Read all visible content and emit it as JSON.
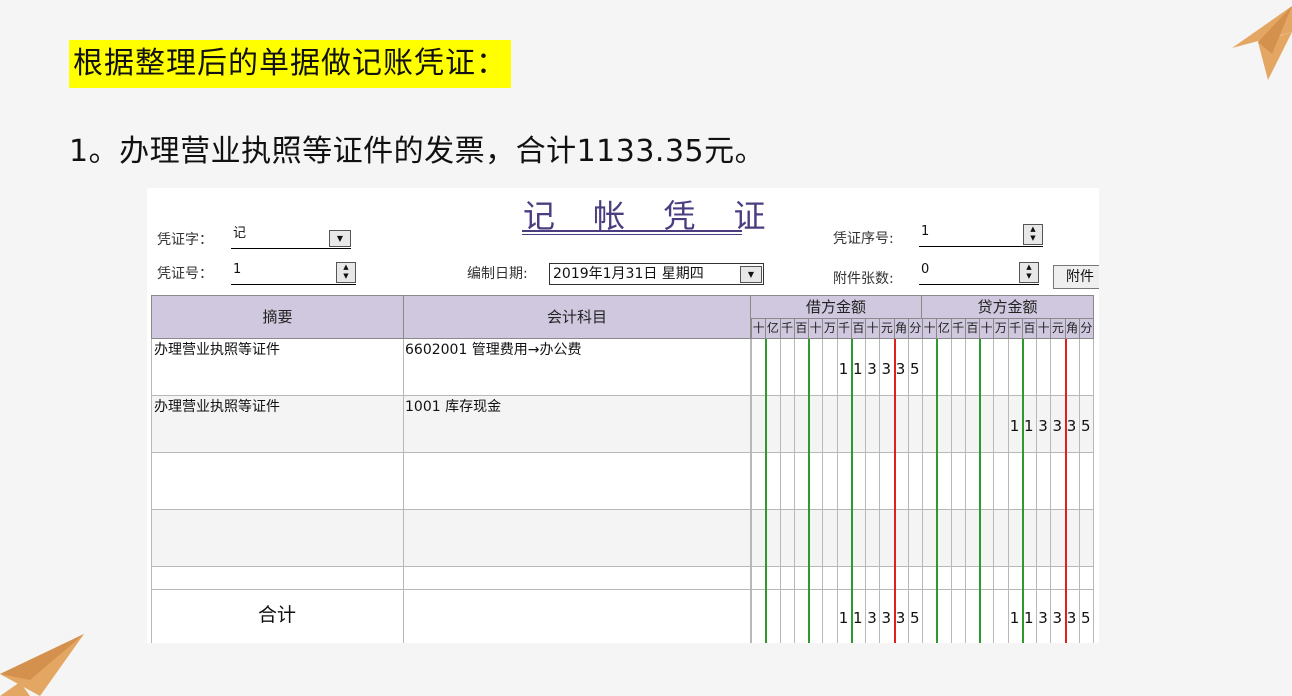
{
  "slide": {
    "title": "根据整理后的单据做记账凭证：",
    "subtitle": "1。办理营业执照等证件的发票，合计1133.35元。",
    "accent_color": "#e4a763",
    "highlight_color": "#ffff00"
  },
  "voucher": {
    "title": "记 帐 凭 证",
    "title_color": "#4b3d80",
    "word_label": "凭证字：",
    "word_value": "记",
    "number_label": "凭证号：",
    "number_value": "1",
    "date_label": "编制日期:",
    "date_value": "2019年1月31日  星期四",
    "seq_label": "凭证序号:",
    "seq_value": "1",
    "attach_label": "附件张数:",
    "attach_value": "0",
    "attach_button": "附件"
  },
  "grid": {
    "header_bg": "#cfc8de",
    "col_summary": "摘要",
    "col_account": "会计科目",
    "col_debit": "借方金额",
    "col_credit": "贷方金额",
    "units": [
      "十",
      "亿",
      "千",
      "百",
      "十",
      "万",
      "千",
      "百",
      "十",
      "元",
      "角",
      "分"
    ],
    "rows": [
      {
        "summary": "办理营业执照等证件",
        "account": "6602001 管理费用→办公费",
        "debit": "113335",
        "credit": ""
      },
      {
        "summary": "办理营业执照等证件",
        "account": "1001 库存现金",
        "debit": "",
        "credit": "113335"
      },
      {
        "summary": "",
        "account": "",
        "debit": "",
        "credit": ""
      },
      {
        "summary": "",
        "account": "",
        "debit": "",
        "credit": ""
      },
      {
        "summary": "",
        "account": "",
        "debit": "",
        "credit": ""
      }
    ],
    "total_label": "合计",
    "total_debit": "113335",
    "total_credit": "113335"
  }
}
